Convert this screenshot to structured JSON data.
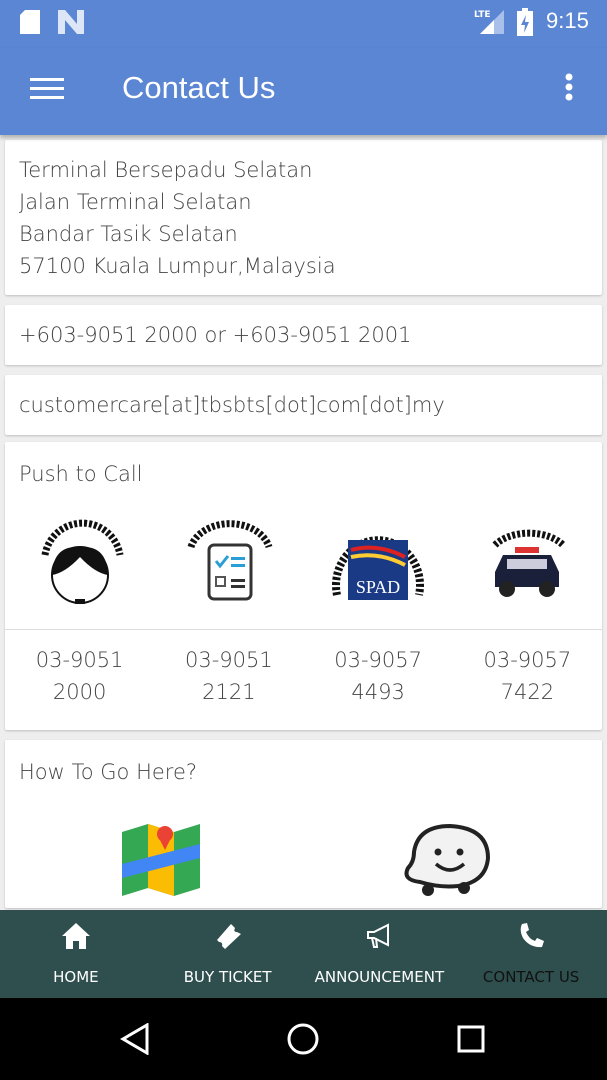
{
  "status_bar": {
    "time": "9:15",
    "network": "LTE"
  },
  "app_bar": {
    "title": "Contact Us",
    "colors": {
      "primary": "#5b86d4"
    }
  },
  "address": [
    "Terminal Bersepadu Selatan",
    "Jalan Terminal Selatan",
    "Bandar Tasik Selatan",
    "57100 Kuala Lumpur,Malaysia"
  ],
  "phone": "+603-9051 2000 or +603-9051 2001",
  "email": "customercare[at]tbsbts[dot]com[dot]my",
  "push_to_call": {
    "title": "Push to Call",
    "items": [
      {
        "logo": "CUSTOMER SERVICE OFFICE",
        "line1": "03-9051",
        "line2": "2000"
      },
      {
        "logo": "MANAGEMENT OFFICE",
        "line1": "03-9051",
        "line2": "2121"
      },
      {
        "logo": "THE LAND PUBLIC TRANSPORT COMMISSION SPAD",
        "line1": "03-9057",
        "line2": "4493"
      },
      {
        "logo": "POLICE POST TBS",
        "line1": "03-9057",
        "line2": "7422"
      }
    ]
  },
  "how_to_go": {
    "title": "How To Go Here?",
    "apps": [
      "google-maps-icon",
      "waze-icon"
    ]
  },
  "bottom_nav": {
    "background": "#2f4f4f",
    "items": [
      {
        "label": "HOME",
        "icon": "home-icon"
      },
      {
        "label": "BUY TICKET",
        "icon": "ticket-icon"
      },
      {
        "label": "ANNOUNCEMENT",
        "icon": "megaphone-icon"
      },
      {
        "label": "CONTACT US",
        "icon": "phone-icon",
        "active": true
      }
    ]
  }
}
